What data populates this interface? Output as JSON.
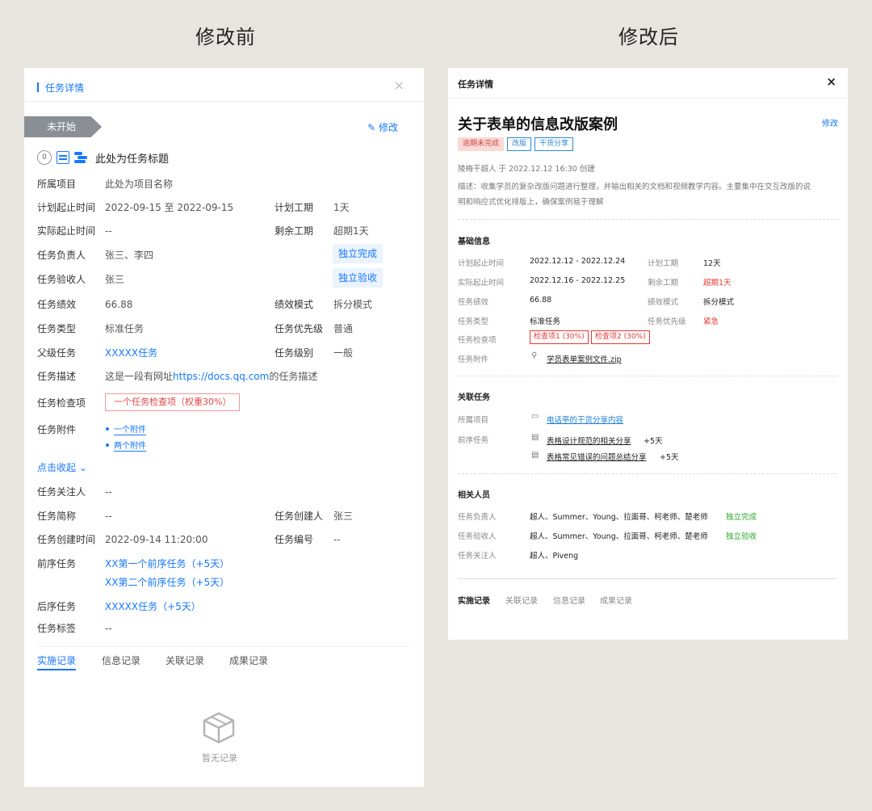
{
  "captions": {
    "before": "修改前",
    "after": "修改后"
  },
  "left": {
    "header_title": "任务详情",
    "close": "×",
    "status": "未开始",
    "edit": "修改",
    "task_title_icon_num": "0",
    "task_title": "此处为任务标题",
    "rows": {
      "project_label": "所属项目",
      "project_value": "此处为项目名称",
      "plan_label": "计划起止时间",
      "plan_value": "2022-09-15 至 2022-09-15",
      "plan_days_label": "计划工期",
      "plan_days_value": "1天",
      "actual_label": "实际起止时间",
      "actual_value": "--",
      "remain_label": "剩余工期",
      "remain_value": "超期1天",
      "owner_label": "任务负责人",
      "owner_value": "张三、李四",
      "owner_btn": "独立完成",
      "accept_label": "任务验收人",
      "accept_value": "张三",
      "accept_btn": "独立验收",
      "perf_label": "任务绩效",
      "perf_value": "66.88",
      "perf_mode_label": "绩效模式",
      "perf_mode_value": "拆分模式",
      "type_label": "任务类型",
      "type_value": "标准任务",
      "priority_label": "任务优先级",
      "priority_value": "普通",
      "parent_label": "父级任务",
      "parent_value": "XXXXX任务",
      "level_label": "任务级别",
      "level_value": "一般",
      "desc_label": "任务描述",
      "desc_pre": "这是一段有网址",
      "desc_link": "https://docs.qq.com",
      "desc_post": "的任务描述",
      "check_label": "任务检查项",
      "check_value": "一个任务检查项（权重30%）",
      "attach_label": "任务附件",
      "attach_1": "一个附件",
      "attach_2": "两个附件",
      "collapse": "点击收起",
      "watcher_label": "任务关注人",
      "watcher_value": "--",
      "short_label": "任务简称",
      "short_value": "--",
      "creator_label": "任务创建人",
      "creator_value": "张三",
      "created_label": "任务创建时间",
      "created_value": "2022-09-14 11:20:00",
      "number_label": "任务编号",
      "number_value": "--",
      "pre_label": "前序任务",
      "pre_1": "XX第一个前序任务（+5天）",
      "pre_2": "XX第二个前序任务（+5天）",
      "post_label": "后序任务",
      "post_value": "XXXXX任务（+5天）",
      "tag_label": "任务标签",
      "tag_value": "--"
    },
    "tabs": [
      "实施记录",
      "信息记录",
      "关联记录",
      "成果记录"
    ],
    "empty": "暂无记录"
  },
  "right": {
    "header_title": "任务详情",
    "close": "×",
    "title": "关于表单的信息改版案例",
    "edit": "修改",
    "tags": [
      "逾期未完成",
      "改版",
      "干货分享"
    ],
    "creator_line": "陵梅干超人 于 2022.12.12 16:30 创建",
    "desc_line1": "描述：收集学员的复杂改版问题进行整理，并输出相关的文档和视频教学内容。主要集中在交互改版的说",
    "desc_line2": "明和响应式优化排版上，确保案例易于理解",
    "basic": {
      "title": "基础信息",
      "plan_label": "计划起止时间",
      "plan_value": "2022.12.12 - 2022.12.24",
      "plan_days_label": "计划工期",
      "plan_days_value": "12天",
      "actual_label": "实际起止时间",
      "actual_value": "2022.12.16 - 2022.12.25",
      "remain_label": "剩余工期",
      "remain_value": "超期1天",
      "perf_label": "任务绩效",
      "perf_value": "66.88",
      "mode_label": "绩效模式",
      "mode_value": "拆分模式",
      "type_label": "任务类型",
      "type_value": "标准任务",
      "prio_label": "任务优先级",
      "prio_value": "紧急",
      "check_label": "任务检查项",
      "check_1": "检查项1 (30%)",
      "check_2": "检查项2 (30%)",
      "attach_label": "任务附件",
      "attach_value": "学员表单案例文件.zip"
    },
    "related": {
      "title": "关联任务",
      "project_label": "所属项目",
      "project_value": "电话亭的干货分享内容",
      "pre_label": "前序任务",
      "pre_1": "表格设计规范的相关分享",
      "pre_1_delay": "+5天",
      "pre_2": "表格常见错误的问题总结分享",
      "pre_2_delay": "+5天"
    },
    "people": {
      "title": "相关人员",
      "owner_label": "任务负责人",
      "owner_value": "超人、Summer、Young、拉面哥、柯老师、楚老师",
      "owner_status": "独立完成",
      "accept_label": "任务验收人",
      "accept_value": "超人、Summer、Young、拉面哥、柯老师、楚老师",
      "accept_status": "独立验收",
      "watch_label": "任务关注人",
      "watch_value": "超人、Piveng"
    },
    "tabs": [
      "实施记录",
      "关联记录",
      "信息记录",
      "成果记录"
    ]
  }
}
